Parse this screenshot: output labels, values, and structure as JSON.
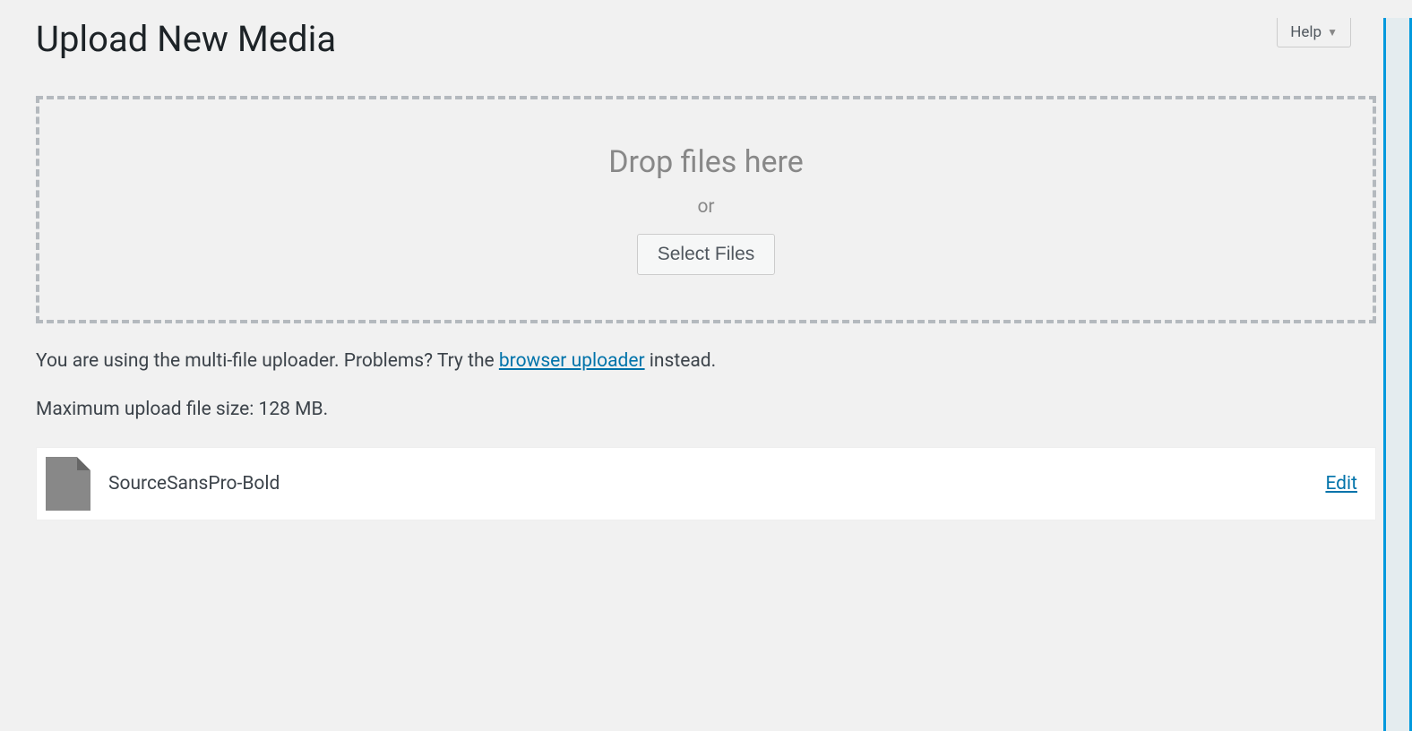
{
  "help_tab": {
    "label": "Help"
  },
  "page": {
    "title": "Upload New Media"
  },
  "dropzone": {
    "drop_text": "Drop files here",
    "or_text": "or",
    "select_button": "Select Files"
  },
  "info": {
    "prefix": "You are using the multi-file uploader. Problems? Try the ",
    "link_text": "browser uploader",
    "suffix": " instead."
  },
  "max_size": {
    "text": "Maximum upload file size: 128 MB."
  },
  "files": [
    {
      "name": "SourceSansPro-Bold",
      "edit_label": "Edit"
    }
  ]
}
